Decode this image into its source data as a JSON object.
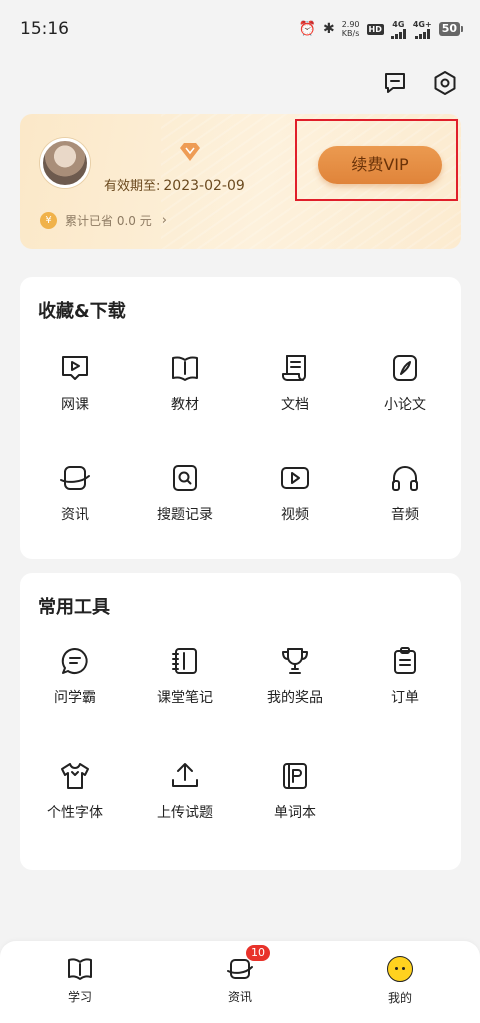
{
  "status_bar": {
    "time": "15:16",
    "net_speed_value": "2.90",
    "net_speed_unit": "KB/s",
    "hd_badge": "HD",
    "signal_1": "4G",
    "signal_2": "4G+",
    "battery": "50"
  },
  "vip_card": {
    "expiry_label": "有效期至:",
    "expiry_date": "2023-02-09",
    "savings_coin": "¥",
    "savings_text": "累计已省 0.0 元",
    "renew_button": "续费VIP"
  },
  "favorites": {
    "title": "收藏&下载",
    "items": [
      {
        "label": "网课",
        "icon": "play-chat-icon"
      },
      {
        "label": "教材",
        "icon": "book-icon"
      },
      {
        "label": "文档",
        "icon": "scroll-document-icon"
      },
      {
        "label": "小论文",
        "icon": "feather-pen-icon"
      },
      {
        "label": "资讯",
        "icon": "planet-icon"
      },
      {
        "label": "搜题记录",
        "icon": "search-record-icon"
      },
      {
        "label": "视频",
        "icon": "video-play-icon"
      },
      {
        "label": "音频",
        "icon": "headphones-icon"
      }
    ]
  },
  "tools": {
    "title": "常用工具",
    "items": [
      {
        "label": "问学霸",
        "icon": "chat-bubble-icon"
      },
      {
        "label": "课堂笔记",
        "icon": "notebook-icon"
      },
      {
        "label": "我的奖品",
        "icon": "trophy-icon"
      },
      {
        "label": "订单",
        "icon": "clipboard-icon"
      },
      {
        "label": "个性字体",
        "icon": "tshirt-icon"
      },
      {
        "label": "上传试题",
        "icon": "upload-icon"
      },
      {
        "label": "单词本",
        "icon": "word-book-icon"
      }
    ]
  },
  "bottom_nav": {
    "items": [
      {
        "label": "学习",
        "icon": "book-icon"
      },
      {
        "label": "资讯",
        "icon": "planet-icon",
        "badge": "10"
      },
      {
        "label": "我的",
        "icon": "smiley-icon"
      }
    ]
  },
  "colors": {
    "accent": "#e0843a",
    "highlight": "#e01e2a",
    "badge": "#e8322a"
  }
}
